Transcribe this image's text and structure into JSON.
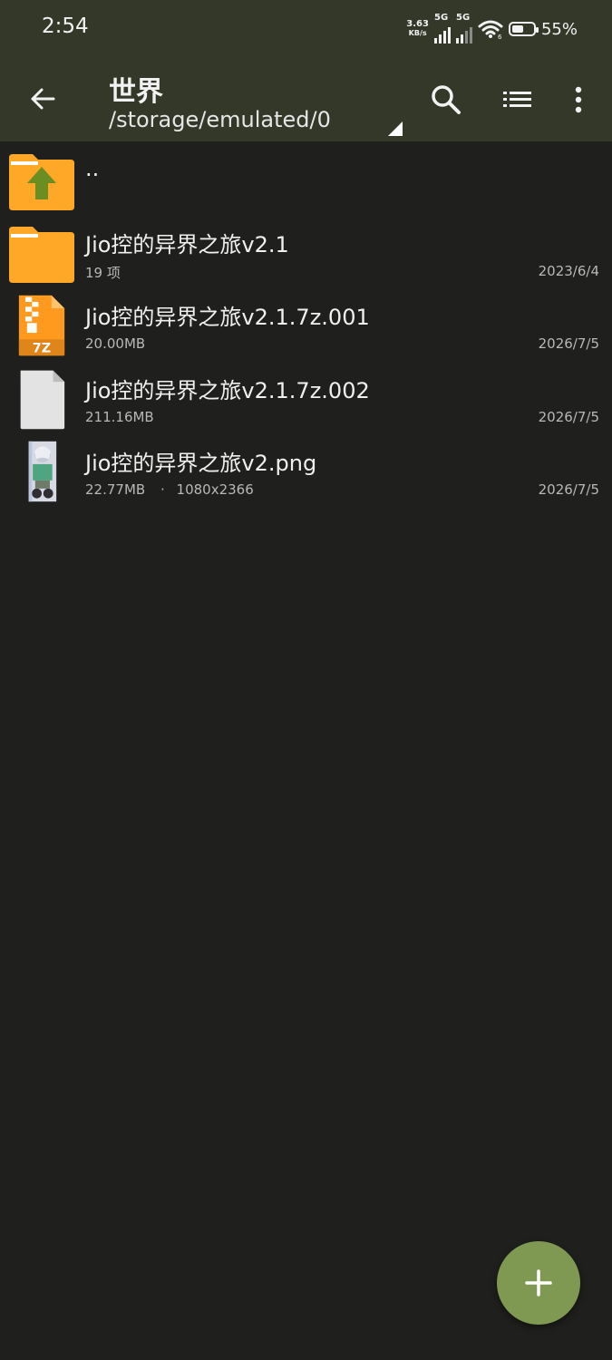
{
  "status_bar": {
    "time": "2:54",
    "net_speed_value": "3.63",
    "net_speed_unit": "KB/s",
    "signal1_tag": "5G",
    "signal2_tag": "5G",
    "wifi_tag": "6",
    "battery_percent": "55%",
    "battery_level": 0.55
  },
  "toolbar": {
    "title": "世界",
    "path": "/storage/emulated/0",
    "back_icon": "arrow-left-icon",
    "search_icon": "search-icon",
    "view_icon": "list-view-icon",
    "more_icon": "more-vert-icon"
  },
  "files": [
    {
      "type": "parent",
      "name": "..",
      "icon": "folder-up-icon"
    },
    {
      "type": "folder",
      "name": "Jio控的异界之旅v2.1",
      "meta": "19 项",
      "date": "2023/6/4",
      "icon": "folder-icon"
    },
    {
      "type": "7z",
      "name": "Jio控的异界之旅v2.1.7z.001",
      "meta": "20.00MB",
      "date": "2026/7/5",
      "icon": "archive-7z-icon",
      "badge": "7Z"
    },
    {
      "type": "file",
      "name": "Jio控的异界之旅v2.1.7z.002",
      "meta": "211.16MB",
      "date": "2026/7/5",
      "icon": "file-icon"
    },
    {
      "type": "image",
      "name": "Jio控的异界之旅v2.png",
      "meta": "22.77MB",
      "dims": "1080x2366",
      "date": "2026/7/5",
      "icon": "image-thumbnail"
    }
  ],
  "fab": {
    "icon": "plus-icon"
  },
  "colors": {
    "toolbar": "#333829",
    "background": "#1f201d",
    "folder": "#ffa726",
    "fab": "#7f9852"
  }
}
